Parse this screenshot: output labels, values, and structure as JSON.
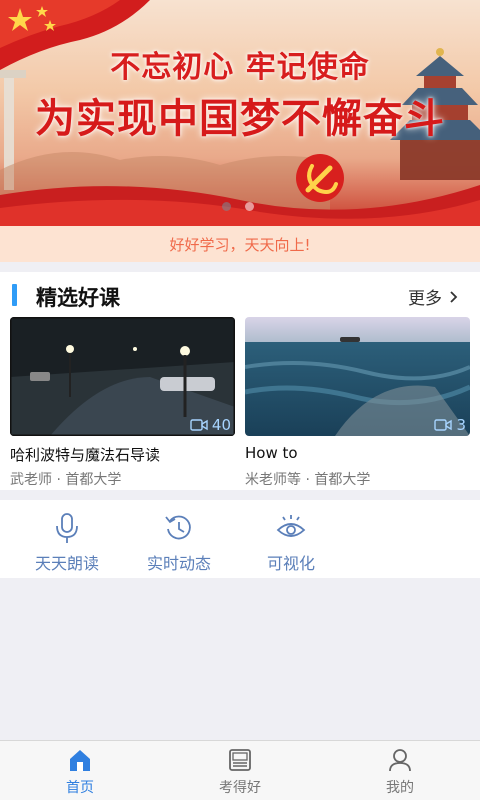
{
  "banner": {
    "slogan_line1": "不忘初心 牢记使命",
    "slogan_line2": "为实现中国梦不懈奋斗",
    "slides_total": 2,
    "active_slide": 1
  },
  "notice": {
    "text": "好好学习，天天向上!"
  },
  "courses": {
    "title": "精选好课",
    "more_label": "更多",
    "items": [
      {
        "title": "哈利波特与魔法石导读",
        "meta": "武老师 · 首都大学",
        "video_count": "40"
      },
      {
        "title": "How to",
        "meta": "米老师等 · 首都大学",
        "video_count": "3"
      }
    ]
  },
  "actions": [
    {
      "label": "天天朗读",
      "icon": "microphone-icon"
    },
    {
      "label": "实时动态",
      "icon": "history-icon"
    },
    {
      "label": "可视化",
      "icon": "eye-icon"
    }
  ],
  "tabbar": {
    "items": [
      {
        "label": "首页",
        "icon": "home-icon",
        "active": true
      },
      {
        "label": "考得好",
        "icon": "exam-icon",
        "active": false
      },
      {
        "label": "我的",
        "icon": "user-icon",
        "active": false
      }
    ]
  },
  "colors": {
    "accent": "#2f9cf7",
    "tab_active": "#2f7fe0",
    "action_icon": "#5b7fb9",
    "notice_text": "#f06a4a",
    "notice_bg": "#fde3d2",
    "banner_red": "#d61a1a"
  }
}
